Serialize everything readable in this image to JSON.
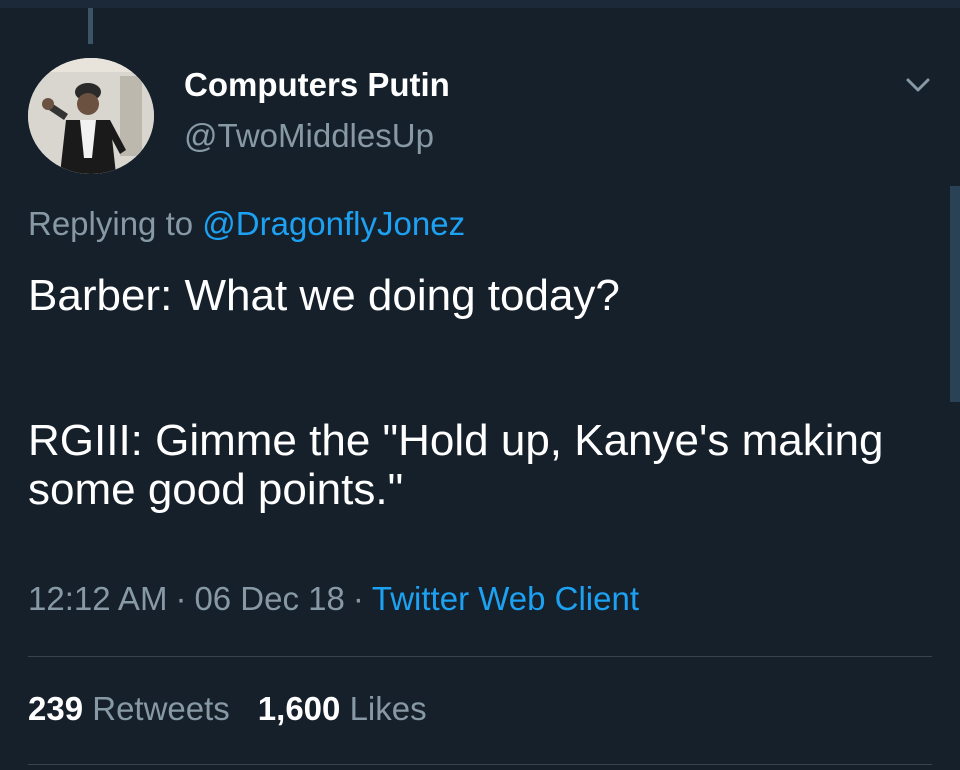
{
  "tweet": {
    "display_name": "Computers Putin",
    "handle": "@TwoMiddlesUp",
    "replying_prefix": "Replying to",
    "replying_to": "@DragonflyJonez",
    "text_line_1": "Barber: What we doing today?",
    "text_line_2": "RGIII: Gimme the \"Hold up, Kanye's making some good points.\"",
    "time": "12:12 AM",
    "date": "06 Dec 18",
    "separator": "·",
    "source": "Twitter Web Client",
    "retweets_count": "239",
    "retweets_label": "Retweets",
    "likes_count": "1,600",
    "likes_label": "Likes"
  },
  "icons": {
    "more": "chevron-down-icon",
    "avatar": "user-avatar"
  },
  "colors": {
    "background": "#15202b",
    "link": "#1da1f2",
    "muted": "#8899a6",
    "divider": "#38444d"
  }
}
